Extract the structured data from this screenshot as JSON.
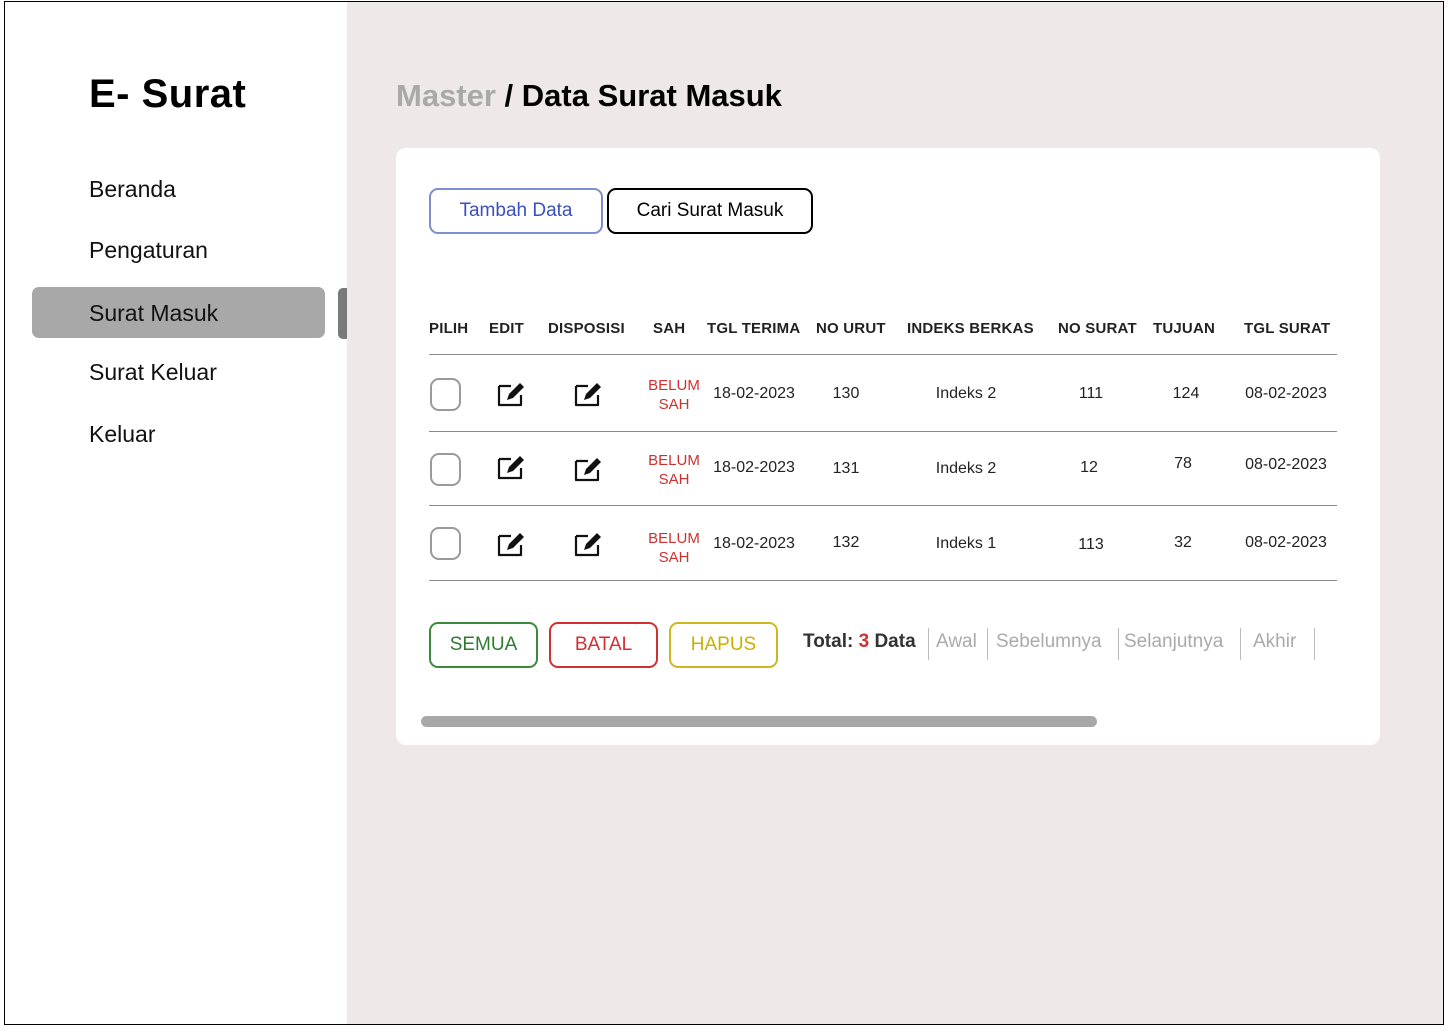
{
  "app": {
    "title": "E- Surat"
  },
  "sidebar": {
    "items": [
      {
        "label": "Beranda"
      },
      {
        "label": "Pengaturan"
      },
      {
        "label": "Surat Masuk"
      },
      {
        "label": "Surat Keluar"
      },
      {
        "label": "Keluar"
      }
    ],
    "active": "Surat Masuk"
  },
  "breadcrumb": {
    "parent": "Master",
    "separator": " / ",
    "current": "Data Surat Masuk"
  },
  "toolbar": {
    "add_label": "Tambah Data",
    "search_label": "Cari Surat Masuk"
  },
  "table": {
    "headers": [
      "PILIH",
      "EDIT",
      "DISPOSISI",
      "SAH",
      "TGL TERIMA",
      "NO URUT",
      "INDEKS BERKAS",
      "NO SURAT",
      "TUJUAN",
      "TGL SURAT"
    ],
    "rows": [
      {
        "sah_line1": "BELUM",
        "sah_line2": "SAH",
        "tgl_terima": "18-02-2023",
        "no_urut": "130",
        "indeks": "Indeks 2",
        "no_surat": "111",
        "tujuan": "124",
        "tgl_surat": "08-02-2023"
      },
      {
        "sah_line1": "BELUM",
        "sah_line2": "SAH",
        "tgl_terima": "18-02-2023",
        "no_urut": "131",
        "indeks": "Indeks 2",
        "no_surat": "12",
        "tujuan": "78",
        "tgl_surat": "08-02-2023"
      },
      {
        "sah_line1": "BELUM",
        "sah_line2": "SAH",
        "tgl_terima": "18-02-2023",
        "no_urut": "132",
        "indeks": "Indeks 1",
        "no_surat": "113",
        "tujuan": "32",
        "tgl_surat": "08-02-2023"
      }
    ]
  },
  "actions": {
    "semua": "SEMUA",
    "batal": "BATAL",
    "hapus": "HAPUS"
  },
  "pagination": {
    "total_prefix": "Total: ",
    "total_count": "3",
    "total_suffix": " Data",
    "first": "Awal",
    "prev": "Sebelumnya",
    "next": "Selanjutnya",
    "last": "Akhir"
  },
  "icons": {
    "edit": "edit-icon",
    "disposisi": "edit-icon"
  },
  "colors": {
    "main_bg": "#efe8e8",
    "active_nav": "#a8a8a8",
    "sah_red": "#d03030",
    "semua_green": "#2f7a2f",
    "hapus_yellow": "#c9b000",
    "tambah_blue": "#3a4fc0"
  }
}
